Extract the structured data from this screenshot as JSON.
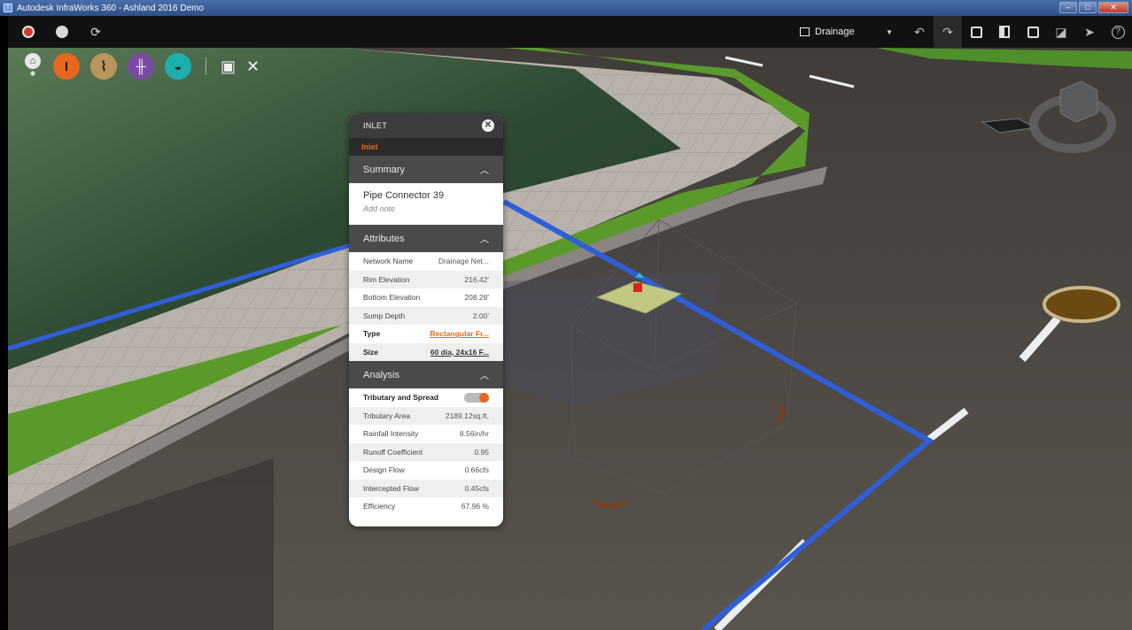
{
  "window": {
    "title": "Autodesk InfraWorks 360 - Ashland 2016 Demo",
    "controls": [
      "minimize",
      "maximize",
      "close"
    ]
  },
  "toolbar": {
    "left_icons": [
      "record-icon",
      "circle-icon",
      "sync-icon"
    ],
    "view_label": "Drainage",
    "right_icons": [
      "undo-icon",
      "redo-icon",
      "snapshot-icon",
      "split-view-icon",
      "fullscreen-icon",
      "measure-icon",
      "select-icon",
      "help-icon"
    ]
  },
  "palette": {
    "items": [
      {
        "name": "home-icon",
        "color": "#e8e8e8"
      },
      {
        "name": "roads-icon",
        "color": "#e8671e"
      },
      {
        "name": "bridge-icon",
        "color": "#c0a36b"
      },
      {
        "name": "rail-icon",
        "color": "#7b4aa6"
      },
      {
        "name": "drainage-icon",
        "color": "#1bb0ad"
      },
      {
        "name": "present-icon",
        "color": "#ffffff"
      },
      {
        "name": "tools-icon",
        "color": "#ffffff"
      }
    ]
  },
  "panel": {
    "header": "INLET",
    "subheader": "Inlet",
    "summary": {
      "title": "Summary",
      "name": "Pipe Connector 39",
      "note": "Add note"
    },
    "attributes": {
      "title": "Attributes",
      "rows": [
        {
          "label": "Network Name",
          "value": "Drainage Net..."
        },
        {
          "label": "Rim Elevation",
          "value": "216.42'"
        },
        {
          "label": "Bottom Elevation",
          "value": "208.28'"
        },
        {
          "label": "Sump Depth",
          "value": "2.00'"
        },
        {
          "label": "Type",
          "value": "Rectangular Fr..."
        },
        {
          "label": "Size",
          "value": "60 dia, 24x16 F..."
        }
      ]
    },
    "analysis": {
      "title": "Analysis",
      "toggle_label": "Tributary and Spread",
      "rows": [
        {
          "label": "Tributary Area",
          "value": "2189.12sq.ft."
        },
        {
          "label": "Rainfall Intensity",
          "value": "8.56in/hr"
        },
        {
          "label": "Runoff Coefficient",
          "value": "0.95"
        },
        {
          "label": "Design Flow",
          "value": "0.66cfs"
        },
        {
          "label": "Intercepted Flow",
          "value": "0.45cfs"
        },
        {
          "label": "Efficiency",
          "value": "67.96 %"
        }
      ]
    }
  },
  "colors": {
    "accent": "#e8671e",
    "pipe": "#2f5fd8",
    "grass": "#5a9a2a",
    "road": "#4a4540",
    "water": "#3d5a3a"
  }
}
